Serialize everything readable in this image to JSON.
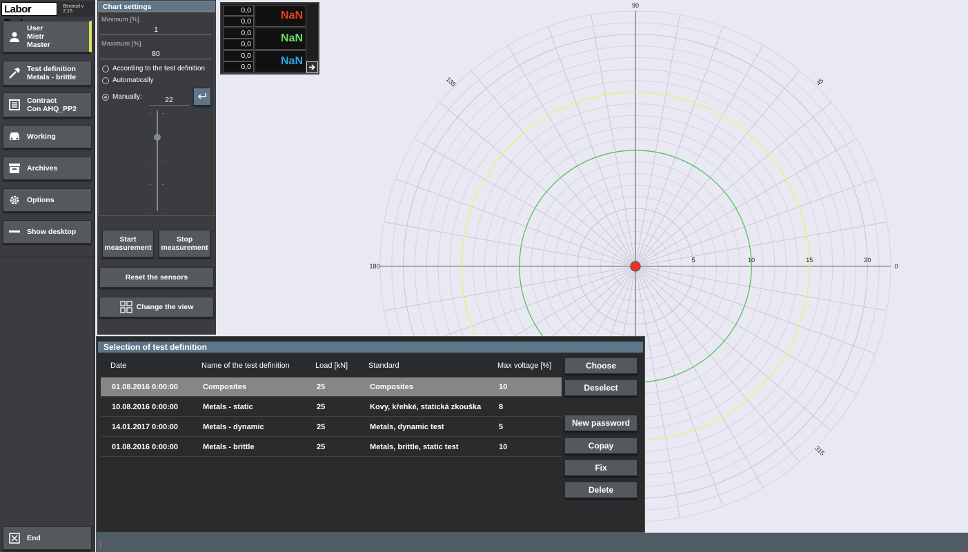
{
  "app": {
    "brand": "Labor Tech",
    "version": "Bentrod v 2.15"
  },
  "nav": {
    "user": {
      "line1": "User",
      "line2": "Mistr",
      "line3": "Master",
      "icon": "user-icon"
    },
    "test_definition": {
      "line1": "Test definition",
      "line2": "Metals - brittle",
      "icon": "hammer-icon"
    },
    "contract": {
      "line1": "Contract",
      "line2": "Con AHQ_PP2",
      "icon": "document-icon"
    },
    "working": {
      "label": "Working",
      "icon": "car-icon"
    },
    "archives": {
      "label": "Archives",
      "icon": "archive-icon"
    },
    "options": {
      "label": "Options",
      "icon": "gear-icon"
    },
    "show_desktop": {
      "label": "Show desktop",
      "icon": "minimize-icon"
    },
    "end": {
      "label": "End",
      "icon": "close-icon"
    }
  },
  "settings": {
    "title": "Chart settings",
    "min_label": "Minimum [%]",
    "min_value": "1",
    "max_label": "Maximum [%]",
    "max_value": "80",
    "opt_test_def": "According to the test definition",
    "opt_auto": "Automatically",
    "opt_manual": "Manually:",
    "manual_value": "22",
    "slider_level": 0.27,
    "start_btn_1": "Start",
    "start_btn_2": "measurement",
    "stop_btn_1": "Stop",
    "stop_btn_2": "measurement",
    "reset_btn": "Reset the sensors",
    "view_btn": "Change the view"
  },
  "values": {
    "rows": [
      {
        "a": "0,0",
        "b": "0,0",
        "nan": "NaN",
        "color": "#e8401c"
      },
      {
        "a": "0,0",
        "b": "0,0",
        "nan": "NaN",
        "color": "#6ddc6d"
      },
      {
        "a": "0,0",
        "b": "0,0",
        "nan": "NaN",
        "color": "#29a8e8"
      }
    ]
  },
  "chart_data": {
    "type": "polar",
    "angle_labels": [
      "90",
      "45",
      "0",
      "315",
      "180",
      "135"
    ],
    "radial_ticks": [
      "5",
      "10",
      "15",
      "20"
    ],
    "circles": [
      {
        "r": 10,
        "color": "#55c060"
      },
      {
        "r": 15,
        "color": "#f0f070"
      }
    ],
    "center_marker": {
      "color": "#ee3322"
    }
  },
  "dialog": {
    "title": "Selection of test definition",
    "headers": [
      "Date",
      "Name of the test definition",
      "Load [kN]",
      "Standard",
      "Max voltage [%]"
    ],
    "rows": [
      [
        "01.08.2016 0:00:00",
        "Composites",
        "25",
        "Composites",
        "10"
      ],
      [
        "10.08.2016 0:00:00",
        "Metals - static",
        "25",
        "Kovy, křehké, statická zkouška",
        "8"
      ],
      [
        "14.01.2017 0:00:00",
        "Metals - dynamic",
        "25",
        "Metals, dynamic test",
        "5"
      ],
      [
        "01.08.2016 0:00:00",
        "Metals - brittle",
        "25",
        "Metals, brittle, static test",
        "10"
      ]
    ],
    "buttons": {
      "choose": "Choose",
      "deselect": "Deselect",
      "new_password": "New password",
      "copy": "Copay",
      "fix": "Fix",
      "delete": "Delete"
    }
  }
}
